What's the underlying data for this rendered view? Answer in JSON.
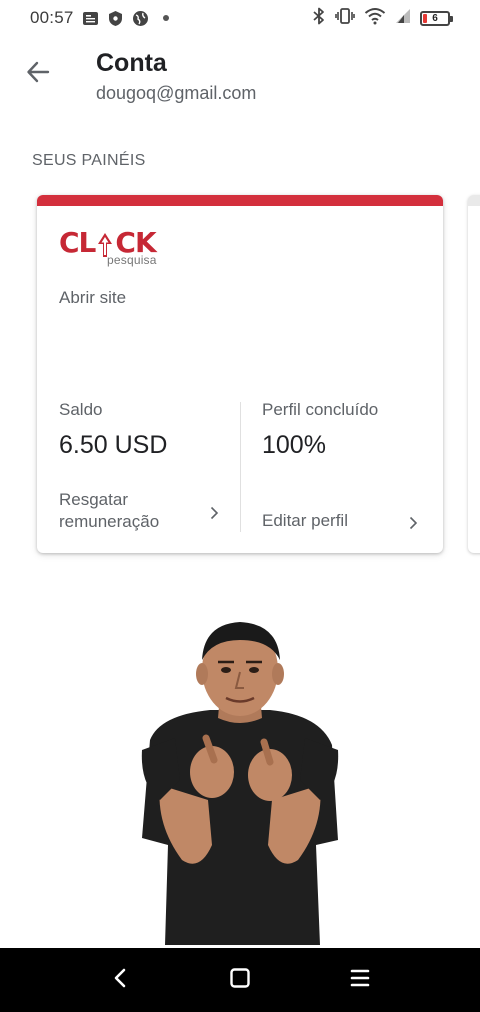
{
  "status_bar": {
    "time": "00:57",
    "battery_level": "6",
    "left_icons": [
      "news-icon",
      "shield-icon",
      "globe-icon",
      "dot-icon"
    ],
    "right_icons": [
      "bluetooth-icon",
      "vibrate-icon",
      "wifi-icon",
      "signal-icon",
      "battery-icon"
    ]
  },
  "header": {
    "title": "Conta",
    "email": "dougoq@gmail.com",
    "back_icon": "arrow-left-icon"
  },
  "panels": {
    "section_label": "SEUS PAINÉIS",
    "card": {
      "accent_color": "#d32f3c",
      "logo_text": "CLICK",
      "logo_subtext": "pesquisa",
      "open_site_label": "Abrir site",
      "balance_label": "Saldo",
      "balance_value": "6.50 USD",
      "redeem_label": "Resgatar remuneração",
      "profile_label": "Perfil concluído",
      "profile_value": "100%",
      "edit_profile_label": "Editar perfil"
    }
  },
  "nav_bar": {
    "buttons": [
      "back-icon",
      "home-icon",
      "recents-icon"
    ]
  },
  "colors": {
    "accent": "#d32f3c",
    "text_primary": "#202124",
    "text_secondary": "#5f6368",
    "nav_background": "#000000"
  }
}
